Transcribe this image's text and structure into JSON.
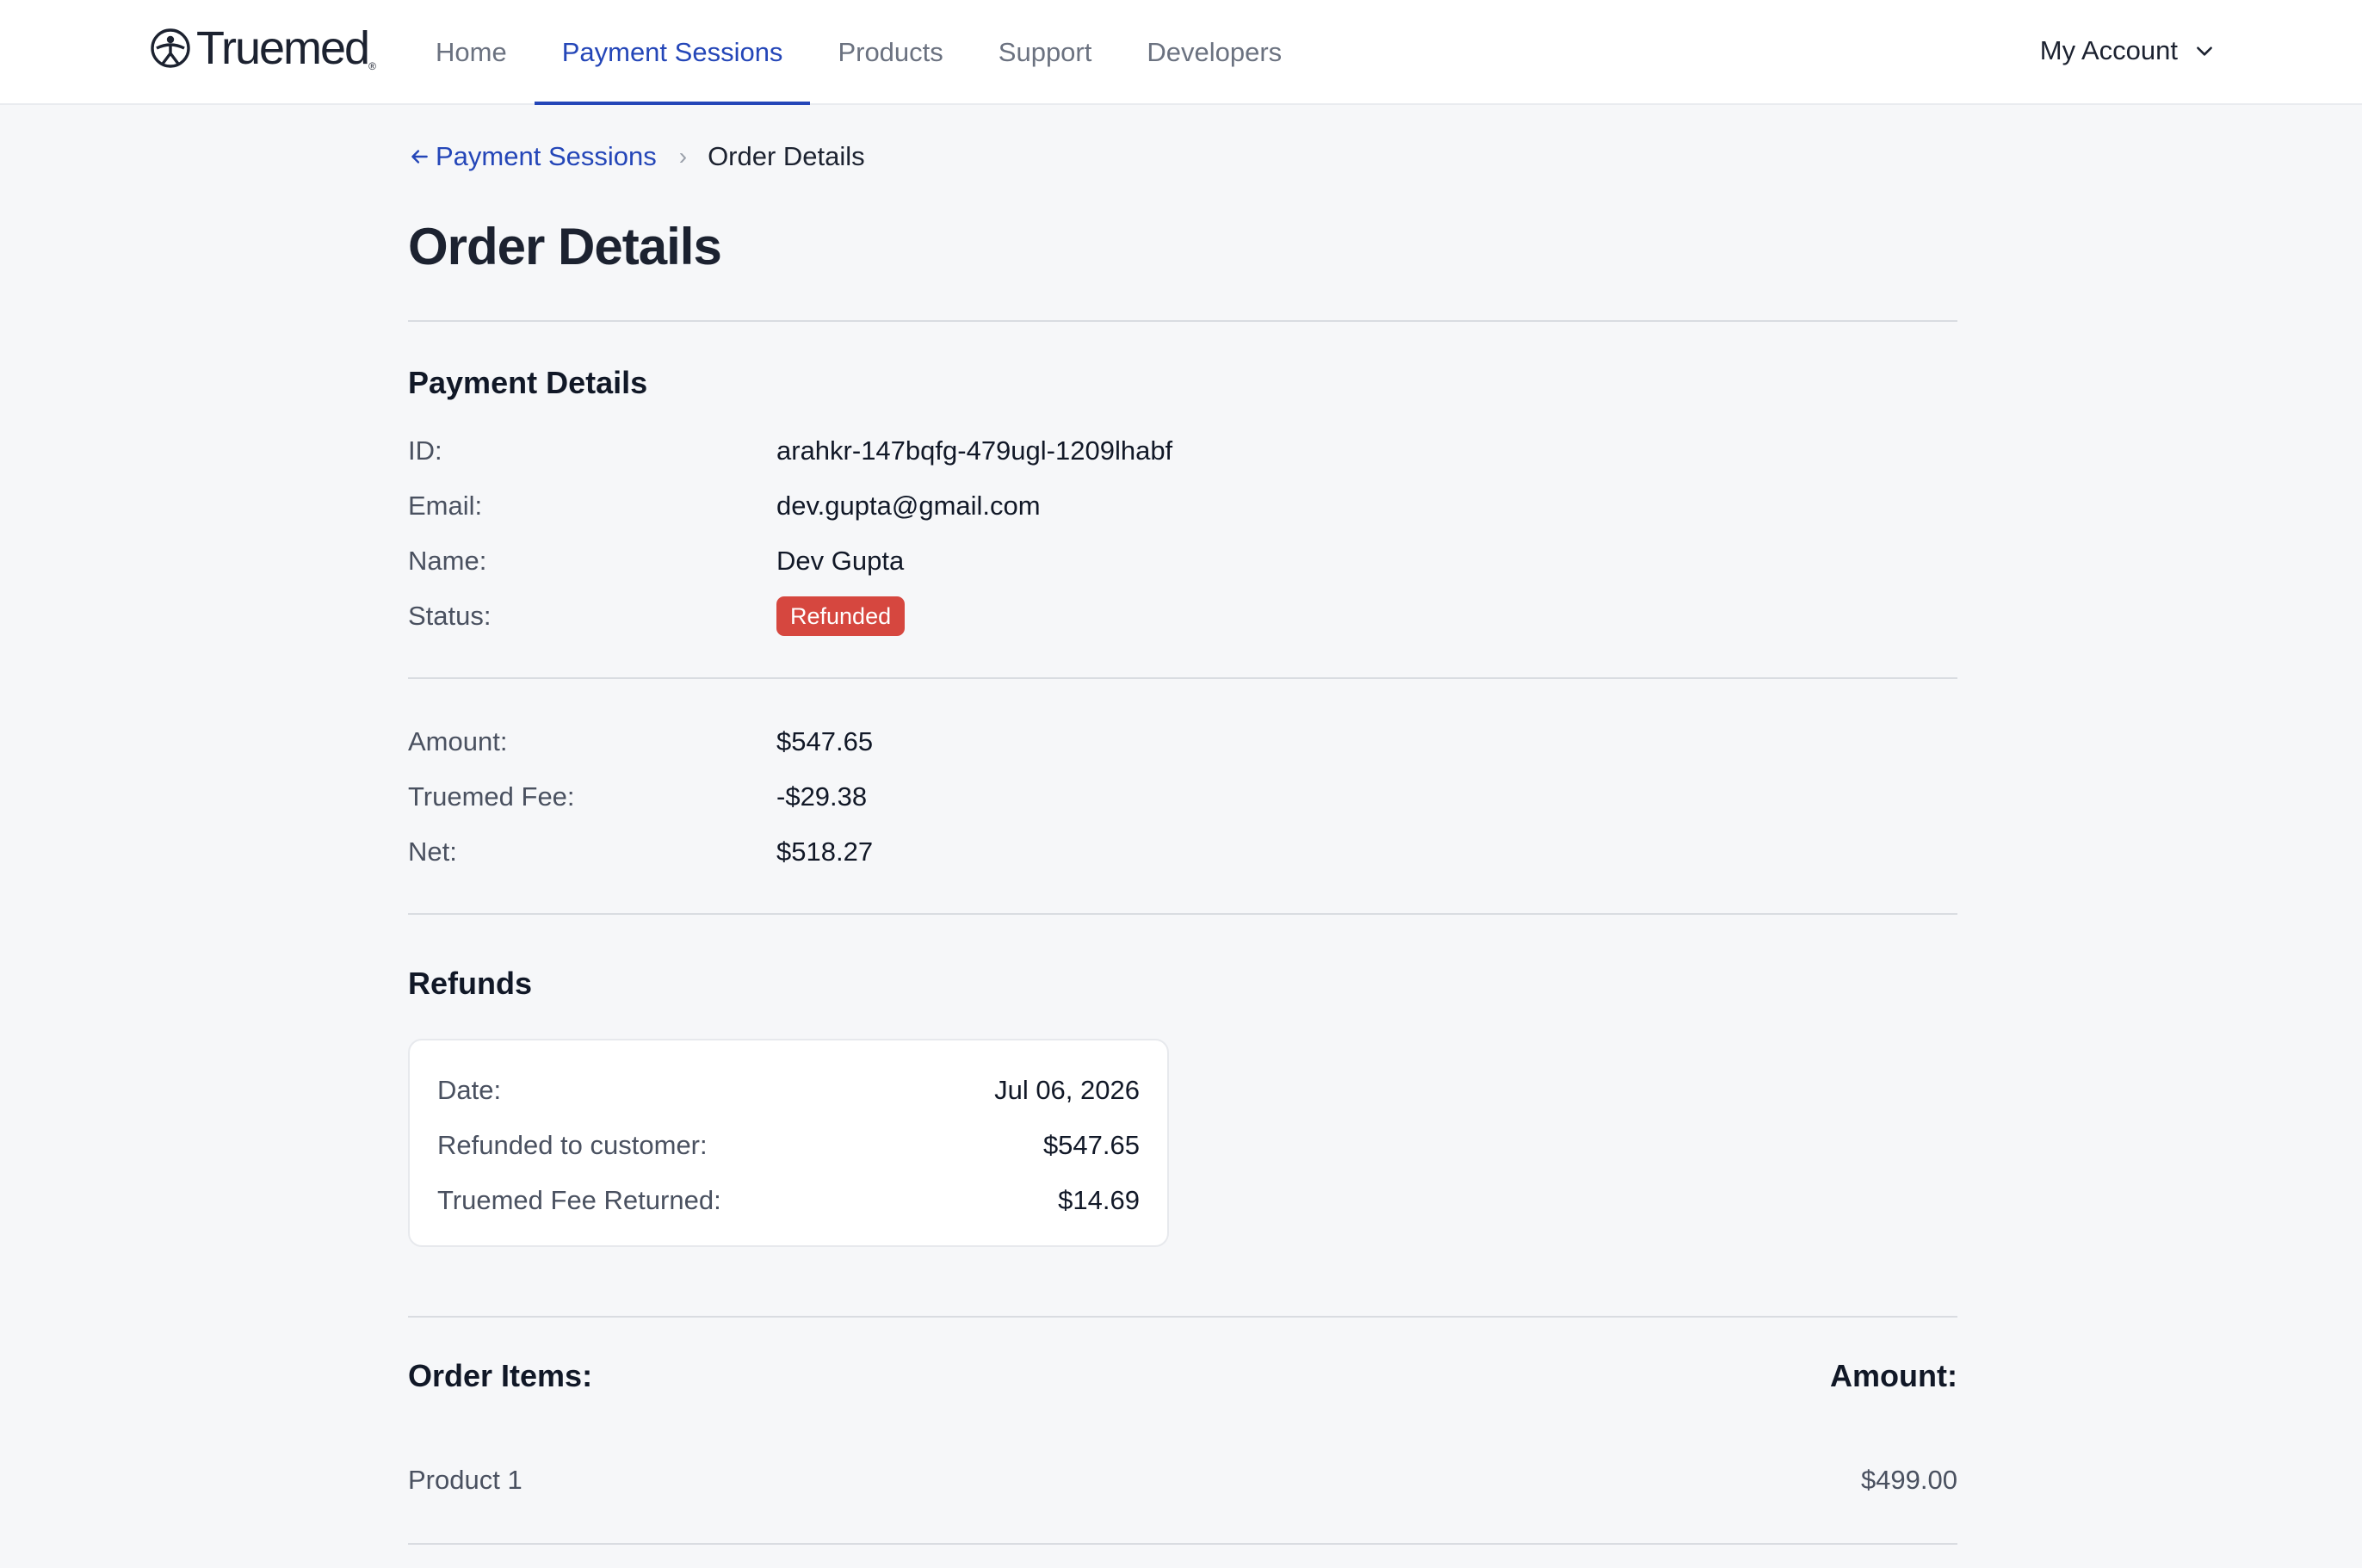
{
  "brand": {
    "name": "Truemed",
    "trademark": "®"
  },
  "nav": {
    "items": [
      {
        "label": "Home"
      },
      {
        "label": "Payment Sessions",
        "active": true
      },
      {
        "label": "Products"
      },
      {
        "label": "Support"
      },
      {
        "label": "Developers"
      }
    ],
    "account_label": "My Account"
  },
  "breadcrumb": {
    "back_label": "Payment Sessions",
    "current": "Order Details"
  },
  "page_title": "Order Details",
  "payment_details": {
    "title": "Payment Details",
    "id": {
      "label": "ID:",
      "value": "arahkr-147bqfg-479ugl-1209lhabf"
    },
    "email": {
      "label": "Email:",
      "value": "dev.gupta@gmail.com"
    },
    "name": {
      "label": "Name:",
      "value": "Dev Gupta"
    },
    "status": {
      "label": "Status:",
      "value": "Refunded",
      "color": "#d6473f"
    }
  },
  "amounts": {
    "amount": {
      "label": "Amount:",
      "value": "$547.65"
    },
    "fee": {
      "label": "Truemed Fee:",
      "value": "-$29.38"
    },
    "net": {
      "label": "Net:",
      "value": "$518.27"
    }
  },
  "refunds": {
    "title": "Refunds",
    "date": {
      "label": "Date:",
      "value": "Jul 06, 2026"
    },
    "refunded": {
      "label": "Refunded to customer:",
      "value": "$547.65"
    },
    "fee_returned": {
      "label": "Truemed Fee Returned:",
      "value": "$14.69"
    }
  },
  "order_items": {
    "header_label": "Order Items:",
    "header_amount": "Amount:",
    "items": [
      {
        "name": "Product 1",
        "amount": "$499.00"
      }
    ]
  },
  "colors": {
    "accent": "#2446b8",
    "danger": "#d6473f",
    "background": "#f6f7f9"
  }
}
